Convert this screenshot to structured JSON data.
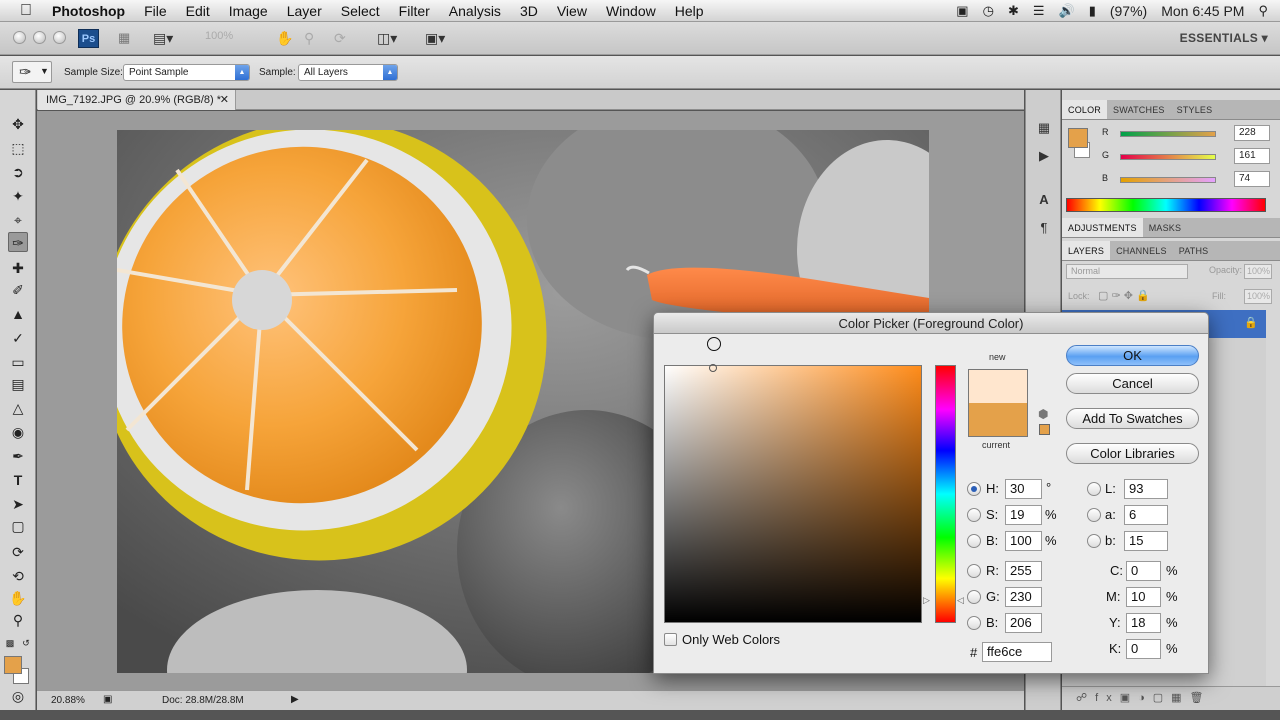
{
  "menubar": {
    "app": "Photoshop",
    "items": [
      "File",
      "Edit",
      "Image",
      "Layer",
      "Select",
      "Filter",
      "Analysis",
      "3D",
      "View",
      "Window",
      "Help"
    ],
    "battery": "(97%)",
    "clock": "Mon 6:45 PM"
  },
  "appbar": {
    "ps_badge": "Ps",
    "zoom_field": "100%",
    "workspace": "ESSENTIALS"
  },
  "options": {
    "sample_size_label": "Sample Size:",
    "sample_size_value": "Point Sample",
    "sample_label": "Sample:",
    "sample_value": "All Layers"
  },
  "document": {
    "tab_title": "IMG_7192.JPG @ 20.9% (RGB/8) *",
    "zoom": "20.88%",
    "doc_info": "Doc: 28.8M/28.8M"
  },
  "color_panel": {
    "tabs": [
      "COLOR",
      "SWATCHES",
      "STYLES"
    ],
    "r_label": "R",
    "g_label": "G",
    "b_label": "B",
    "r": "228",
    "g": "161",
    "b": "74",
    "foreground_color": "#e4a14a"
  },
  "adjust_panel": {
    "tabs": [
      "ADJUSTMENTS",
      "MASKS"
    ]
  },
  "layers_panel": {
    "tabs": [
      "LAYERS",
      "CHANNELS",
      "PATHS"
    ],
    "blend_mode": "Normal",
    "opacity_label": "Opacity:",
    "opacity": "100%",
    "lock_label": "Lock:",
    "fill_label": "Fill:",
    "fill": "100%"
  },
  "color_picker": {
    "title": "Color Picker (Foreground Color)",
    "new_label": "new",
    "current_label": "current",
    "new_color": "#ffe6ce",
    "current_color": "#e4a14a",
    "buttons": {
      "ok": "OK",
      "cancel": "Cancel",
      "add_swatches": "Add To Swatches",
      "libraries": "Color Libraries"
    },
    "hsb": {
      "h_label": "H:",
      "h": "30",
      "h_unit": "°",
      "s_label": "S:",
      "s": "19",
      "s_unit": "%",
      "b_label": "B:",
      "b": "100",
      "b_unit": "%"
    },
    "rgb": {
      "r_label": "R:",
      "r": "255",
      "g_label": "G:",
      "g": "230",
      "b_label": "B:",
      "b": "206"
    },
    "lab": {
      "l_label": "L:",
      "l": "93",
      "a_label": "a:",
      "a": "6",
      "b_label": "b:",
      "b": "15"
    },
    "cmyk": {
      "c_label": "C:",
      "c": "0",
      "m_label": "M:",
      "m": "10",
      "y_label": "Y:",
      "y": "18",
      "k_label": "K:",
      "k": "0",
      "unit": "%"
    },
    "hex_label": "#",
    "hex": "ffe6ce",
    "only_web_colors": "Only Web Colors"
  }
}
